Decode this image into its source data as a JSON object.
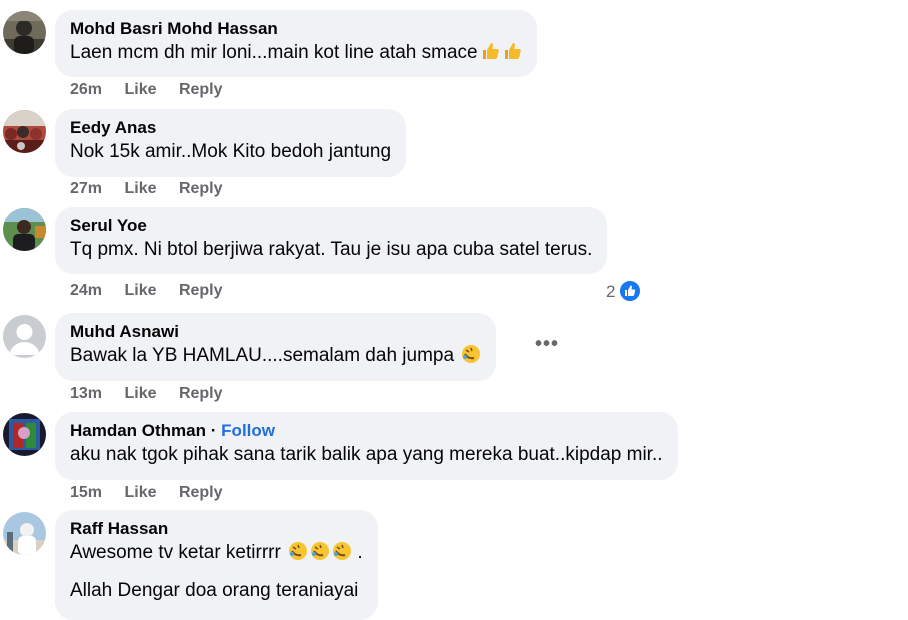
{
  "comments": [
    {
      "name": "Mohd Basri Mohd Hassan",
      "text": "Laen mcm dh mir loni...main kot line atah smace",
      "emoji": "thumbs-up-icon",
      "time": "26m",
      "like": "Like",
      "reply": "Reply"
    },
    {
      "name": "Eedy Anas",
      "text": "Nok 15k amir..Mok Kito bedoh jantung",
      "time": "27m",
      "like": "Like",
      "reply": "Reply"
    },
    {
      "name": "Serul Yoe",
      "text": "Tq pmx. Ni btol berjiwa rakyat. Tau je isu apa cuba satel terus.",
      "time": "24m",
      "like": "Like",
      "reply": "Reply",
      "reaction_count": "2"
    },
    {
      "name": "Muhd Asnawi",
      "text": "Bawak la YB HAMLAU....semalam dah jumpa",
      "emoji": "rolling-laughing-icon",
      "time": "13m",
      "like": "Like",
      "reply": "Reply",
      "more": "•••"
    },
    {
      "name": "Hamdan Othman",
      "follow": "Follow",
      "separator": "·",
      "text": "aku nak tgok pihak sana tarik balik apa yang mereka buat..kipdap mir..",
      "time": "15m",
      "like": "Like",
      "reply": "Reply"
    },
    {
      "name": "Raff Hassan",
      "text": "Awesome tv ketar ketirrrr",
      "emoji": "rolling-laughing-icon",
      "text_end": ".",
      "text2": "Allah Dengar doa orang teraniayai"
    }
  ],
  "colors": {
    "bubble": "#f0f2f5",
    "secondary": "#65676b",
    "link": "#216fdb",
    "like_blue": "#1877f2"
  }
}
